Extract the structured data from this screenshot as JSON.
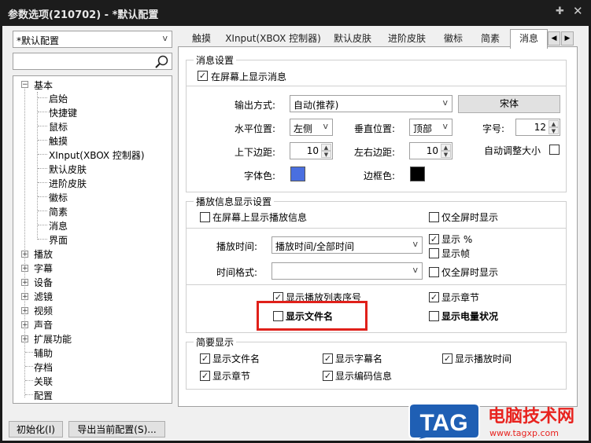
{
  "window": {
    "title": "参数选项(210702) - *默认配置",
    "pin_icon": "pin-icon",
    "close_icon": "close-icon"
  },
  "left": {
    "profile_select": "*默认配置",
    "search_placeholder": "",
    "tree": {
      "basic": "基本",
      "basic_children": [
        "启始",
        "快捷键",
        "鼠标",
        "触摸",
        "XInput(XBOX 控制器)",
        "默认皮肤",
        "进阶皮肤",
        "徽标",
        "简素",
        "消息",
        "界面"
      ],
      "groups": [
        "播放",
        "字幕",
        "设备",
        "滤镜",
        "视频",
        "声音",
        "扩展功能"
      ],
      "leaves": [
        "辅助",
        "存档",
        "关联",
        "配置"
      ]
    }
  },
  "tabs": [
    "触摸",
    "XInput(XBOX 控制器)",
    "默认皮肤",
    "进阶皮肤",
    "徽标",
    "简素",
    "消息"
  ],
  "active_tab": "消息",
  "msg": {
    "group_title": "消息设置",
    "show_on_screen": "在屏幕上显示消息",
    "output_label": "输出方式:",
    "output_value": "自动(推荐)",
    "font_button": "宋体",
    "hpos_label": "水平位置:",
    "hpos_value": "左侧",
    "vpos_label": "垂直位置:",
    "vpos_value": "顶部",
    "size_label": "字号:",
    "size_value": "12",
    "tb_margin_label": "上下边距:",
    "tb_margin_value": "10",
    "lr_margin_label": "左右边距:",
    "lr_margin_value": "10",
    "auto_size": "自动调整大小",
    "font_color_label": "字体色:",
    "border_color_label": "边框色:",
    "font_color": "#4a6fe0",
    "border_color": "#000000"
  },
  "play": {
    "group_title": "播放信息显示设置",
    "show_play_info": "在屏幕上显示播放信息",
    "fullscreen_only": "仅全屏时显示",
    "play_time_label": "播放时间:",
    "play_time_value": "播放时间/全部时间",
    "show_percent": "显示 %",
    "show_frame": "显示帧",
    "time_format_label": "时间格式:",
    "time_format_value": "",
    "fullscreen_only2": "仅全屏时显示",
    "show_playlist_no": "显示播放列表序号",
    "show_chapter": "显示章节",
    "show_filename": "显示文件名",
    "show_battery": "显示电量状况"
  },
  "brief": {
    "group_title": "简要显示",
    "items": [
      "显示文件名",
      "显示字幕名",
      "显示播放时间",
      "显示章节",
      "显示编码信息"
    ]
  },
  "footer": {
    "init_button": "初始化(I)",
    "export_button": "导出当前配置(S)..."
  },
  "watermark": {
    "logo": "TAG",
    "site_name": "电脑技术网",
    "url": "www.tagxp.com"
  },
  "colors": {
    "titlebar": "#1c1c1c",
    "highlight": "#e0201a",
    "watermark_blue": "#1f5fb4"
  }
}
